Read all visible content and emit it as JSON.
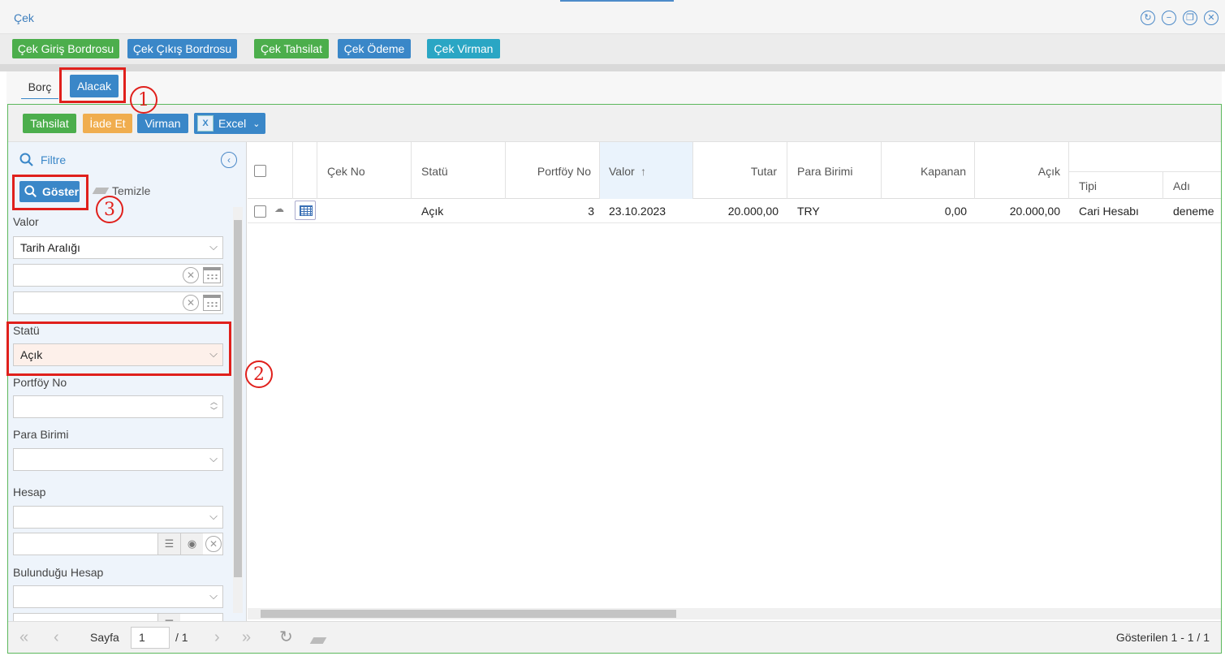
{
  "window": {
    "title": "Çek",
    "controls": [
      "refresh-icon",
      "minimize-icon",
      "restore-icon",
      "close-icon"
    ]
  },
  "toolbar": {
    "btn1": "Çek Giriş Bordrosu",
    "btn2": "Çek Çıkış Bordrosu",
    "btn3": "Çek Tahsilat",
    "btn4": "Çek Ödeme",
    "btn5": "Çek Virman"
  },
  "tabs": {
    "borc": "Borç",
    "alacak": "Alacak"
  },
  "actions": {
    "tahsilat": "Tahsilat",
    "iade": "İade Et",
    "virman": "Virman",
    "excel": "Excel"
  },
  "filter": {
    "title": "Filtre",
    "show": "Göster",
    "clear": "Temizle",
    "valor_label": "Valor",
    "valor_mode": "Tarih Aralığı",
    "statu_label": "Statü",
    "statu_value": "Açık",
    "portfoy_label": "Portföy No",
    "para_label": "Para Birimi",
    "hesap_label": "Hesap",
    "bulundugu_label": "Bulunduğu Hesap"
  },
  "grid": {
    "headers": {
      "cek_no": "Çek No",
      "statu": "Statü",
      "portfoy_no": "Portföy No",
      "valor": "Valor",
      "tutar": "Tutar",
      "para_birimi": "Para Birimi",
      "kapanan": "Kapanan",
      "acik": "Açık",
      "tipi": "Tipi",
      "adi": "Adı"
    },
    "rows": [
      {
        "cek_no": "",
        "statu": "Açık",
        "portfoy_no": "3",
        "valor": "23.10.2023",
        "tutar": "20.000,00",
        "para_birimi": "TRY",
        "kapanan": "0,00",
        "acik": "20.000,00",
        "tipi": "Cari Hesabı",
        "adi": "deneme"
      }
    ]
  },
  "pager": {
    "label": "Sayfa",
    "page": "1",
    "total": "/ 1",
    "summary": "Gösterilen 1 - 1 / 1"
  },
  "annotations": {
    "n1": "1",
    "n2": "2",
    "n3": "3"
  },
  "colors": {
    "green": "#4cae4c",
    "blue": "#3a87c8",
    "teal": "#2aa6c4",
    "orange": "#f0ad4e",
    "annotation_red": "#e0201c"
  }
}
